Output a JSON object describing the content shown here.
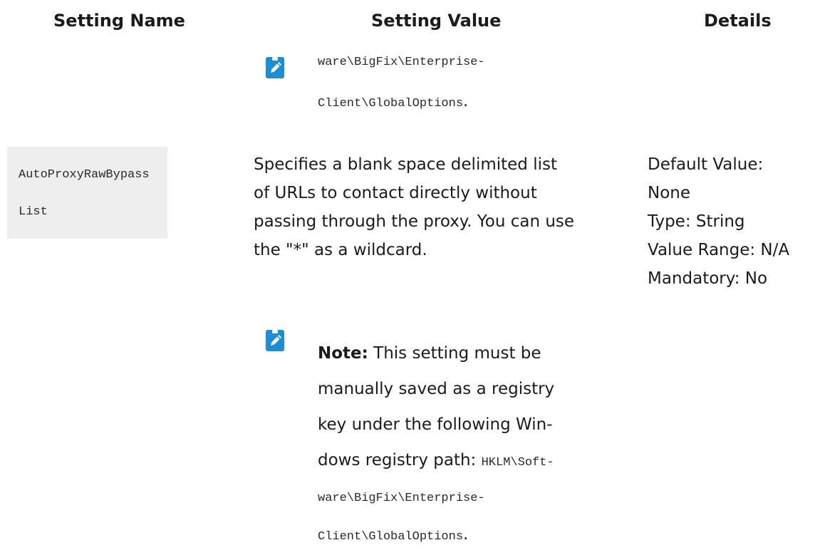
{
  "table": {
    "headers": [
      "Setting Name",
      "Setting Value",
      "Details"
    ]
  },
  "prev_row": {
    "path_line1": "ware\\BigFix\\Enterprise-",
    "path_line2": "Client\\GlobalOptions",
    "path_end": "."
  },
  "row": {
    "name_line1": "AutoProxyRawBypass",
    "name_line2": "List",
    "value_lines": [
      "Specifies a blank space delimited list",
      "of URLs to contact directly without",
      "passing through the proxy. You can use",
      "the \"*\" as a wildcard."
    ],
    "details": [
      "Default Value:",
      "None",
      "Type: String",
      "Value Range: N/A",
      "Mandatory: No"
    ],
    "note": {
      "label": "Note:",
      "line1": " This setting must be",
      "line2": "manually saved as a registry",
      "line3": "key under the following Win-",
      "line4_text": "dows registry path: ",
      "line4_code": "HKLM\\Soft-",
      "line5_code": "ware\\BigFix\\Enterprise-",
      "line6_code": "Client\\GlobalOptions",
      "line6_end": "."
    }
  },
  "icons": {
    "note": "pencil-note-icon"
  },
  "colors": {
    "note_icon": "#1a8fd6",
    "key_cell_bg": "#eeeeee"
  }
}
